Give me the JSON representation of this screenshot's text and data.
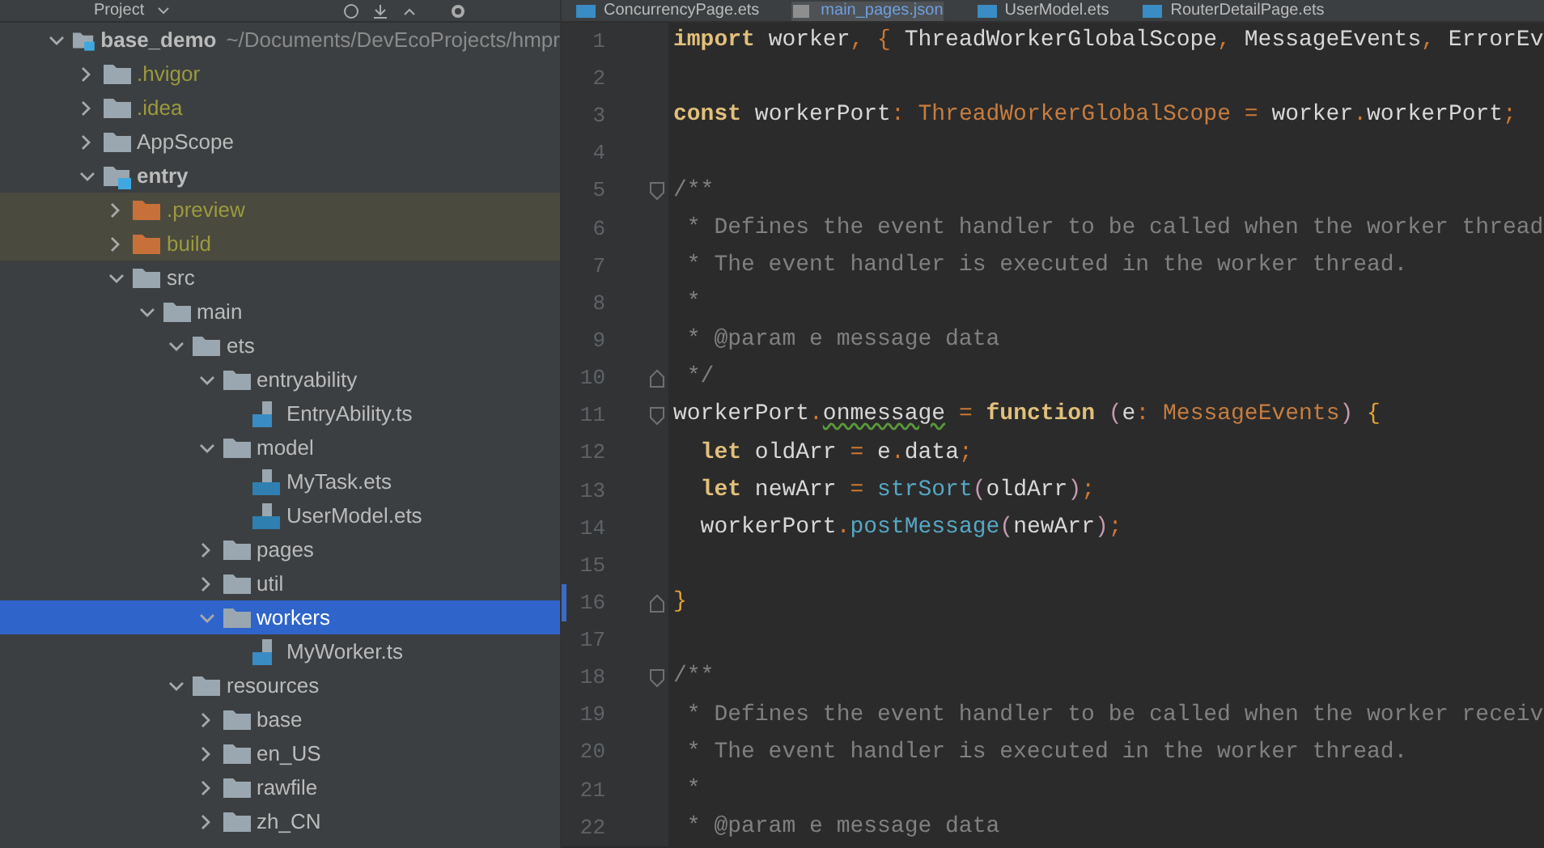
{
  "project_panel": {
    "title": "Project"
  },
  "editor_tabs": [
    {
      "label": "ConcurrencyPage.ets",
      "kind": "ets",
      "selected": false
    },
    {
      "label": "main_pages.json",
      "kind": "json",
      "selected": true
    },
    {
      "label": "UserModel.ets",
      "kind": "ets",
      "selected": false
    },
    {
      "label": "RouterDetailPage.ets",
      "kind": "ets",
      "selected": false
    }
  ],
  "tree": [
    {
      "name": "base_demo",
      "path": "~/Documents/DevEcoProjects/hmpr",
      "kind": "module",
      "expanded": true,
      "selected": false,
      "children": [
        {
          "name": ".hvigor",
          "kind": "folder",
          "expanded": false,
          "ignored": true,
          "excluded": false,
          "selected": false
        },
        {
          "name": ".idea",
          "kind": "folder",
          "expanded": false,
          "ignored": true,
          "excluded": false,
          "selected": false
        },
        {
          "name": "AppScope",
          "kind": "folder",
          "expanded": false,
          "ignored": false,
          "excluded": false,
          "selected": false
        },
        {
          "name": "entry",
          "kind": "module",
          "expanded": true,
          "ignored": false,
          "excluded": false,
          "selected": false,
          "children": [
            {
              "name": ".preview",
              "kind": "folder",
              "expanded": false,
              "ignored": true,
              "excluded": true,
              "selected": false
            },
            {
              "name": "build",
              "kind": "folder",
              "expanded": false,
              "ignored": true,
              "excluded": true,
              "selected": false
            },
            {
              "name": "src",
              "kind": "folder",
              "expanded": true,
              "ignored": false,
              "excluded": false,
              "selected": false,
              "children": [
                {
                  "name": "main",
                  "kind": "folder",
                  "expanded": true,
                  "ignored": false,
                  "excluded": false,
                  "selected": false,
                  "children": [
                    {
                      "name": "ets",
                      "kind": "folder",
                      "expanded": true,
                      "ignored": false,
                      "excluded": false,
                      "selected": false,
                      "children": [
                        {
                          "name": "entryability",
                          "kind": "folder",
                          "expanded": true,
                          "ignored": false,
                          "excluded": false,
                          "selected": false,
                          "children": [
                            {
                              "name": "EntryAbility.ts",
                              "kind": "ts",
                              "ignored": false,
                              "excluded": false,
                              "selected": false
                            }
                          ]
                        },
                        {
                          "name": "model",
                          "kind": "folder",
                          "expanded": true,
                          "ignored": false,
                          "excluded": false,
                          "selected": false,
                          "children": [
                            {
                              "name": "MyTask.ets",
                              "kind": "ets",
                              "ignored": false,
                              "excluded": false,
                              "selected": false
                            },
                            {
                              "name": "UserModel.ets",
                              "kind": "ets",
                              "ignored": false,
                              "excluded": false,
                              "selected": false
                            }
                          ]
                        },
                        {
                          "name": "pages",
                          "kind": "folder",
                          "expanded": false,
                          "ignored": false,
                          "excluded": false,
                          "selected": false
                        },
                        {
                          "name": "util",
                          "kind": "folder",
                          "expanded": false,
                          "ignored": false,
                          "excluded": false,
                          "selected": false
                        },
                        {
                          "name": "workers",
                          "kind": "folder",
                          "expanded": true,
                          "ignored": false,
                          "excluded": false,
                          "selected": true,
                          "children": [
                            {
                              "name": "MyWorker.ts",
                              "kind": "ts",
                              "ignored": false,
                              "excluded": false,
                              "selected": false
                            }
                          ]
                        }
                      ]
                    },
                    {
                      "name": "resources",
                      "kind": "folder",
                      "expanded": true,
                      "ignored": false,
                      "excluded": false,
                      "selected": false,
                      "children": [
                        {
                          "name": "base",
                          "kind": "folder",
                          "expanded": false,
                          "ignored": false,
                          "excluded": false,
                          "selected": false
                        },
                        {
                          "name": "en_US",
                          "kind": "folder",
                          "expanded": false,
                          "ignored": false,
                          "excluded": false,
                          "selected": false
                        },
                        {
                          "name": "rawfile",
                          "kind": "folder",
                          "expanded": false,
                          "ignored": false,
                          "excluded": false,
                          "selected": false
                        },
                        {
                          "name": "zh_CN",
                          "kind": "folder",
                          "expanded": false,
                          "ignored": false,
                          "excluded": false,
                          "selected": false
                        }
                      ]
                    }
                  ]
                }
              ]
            }
          ]
        }
      ]
    }
  ],
  "code": [
    {
      "number": "1",
      "kind": "plain",
      "tokens": [
        {
          "kind": "kw",
          "text": "import"
        },
        {
          "kind": "id",
          "text": " worker"
        },
        {
          "kind": "op",
          "text": ", { "
        },
        {
          "kind": "id",
          "text": "ThreadWorkerGlobalScope"
        },
        {
          "kind": "op",
          "text": ", "
        },
        {
          "kind": "id",
          "text": "MessageEvents"
        },
        {
          "kind": "op",
          "text": ", "
        },
        {
          "kind": "id",
          "text": "ErrorEv"
        }
      ]
    },
    {
      "number": "2",
      "kind": "plain"
    },
    {
      "number": "3",
      "kind": "plain",
      "tokens": [
        {
          "kind": "kw",
          "text": "const"
        },
        {
          "kind": "id",
          "text": " workerPort"
        },
        {
          "kind": "op",
          "text": ": "
        },
        {
          "kind": "type",
          "text": "ThreadWorkerGlobalScope"
        },
        {
          "kind": "op",
          "text": " = "
        },
        {
          "kind": "id",
          "text": "worker"
        },
        {
          "kind": "op",
          "text": "."
        },
        {
          "kind": "id",
          "text": "workerPort"
        },
        {
          "kind": "op",
          "text": ";"
        }
      ]
    },
    {
      "number": "4",
      "kind": "plain"
    },
    {
      "number": "5",
      "kind": "fold-start",
      "tokens": [
        {
          "kind": "cm",
          "text": "/**"
        }
      ]
    },
    {
      "number": "6",
      "kind": "plain",
      "tokens": [
        {
          "kind": "cm",
          "text": " * Defines the event handler to be called when the worker thread"
        }
      ]
    },
    {
      "number": "7",
      "kind": "plain",
      "tokens": [
        {
          "kind": "cm",
          "text": " * The event handler is executed in the worker thread."
        }
      ]
    },
    {
      "number": "8",
      "kind": "plain",
      "tokens": [
        {
          "kind": "cm",
          "text": " *"
        }
      ]
    },
    {
      "number": "9",
      "kind": "plain",
      "tokens": [
        {
          "kind": "cm",
          "text": " * @param e message data"
        }
      ]
    },
    {
      "number": "10",
      "kind": "fold-end",
      "tokens": [
        {
          "kind": "cm",
          "text": " */"
        }
      ]
    },
    {
      "number": "11",
      "kind": "fold-start",
      "tokens": [
        {
          "kind": "id",
          "text": "workerPort"
        },
        {
          "kind": "op",
          "text": "."
        },
        {
          "kind": "warn",
          "text": "onmessage"
        },
        {
          "kind": "op",
          "text": " = "
        },
        {
          "kind": "kw",
          "text": "function"
        },
        {
          "kind": "paren",
          "text": " ("
        },
        {
          "kind": "id",
          "text": "e"
        },
        {
          "kind": "op",
          "text": ": "
        },
        {
          "kind": "type",
          "text": "MessageEvents"
        },
        {
          "kind": "paren",
          "text": ")"
        },
        {
          "kind": "brace",
          "text": " {"
        }
      ]
    },
    {
      "number": "12",
      "kind": "plain",
      "tokens": [
        {
          "kind": "kw",
          "text": "  let"
        },
        {
          "kind": "id",
          "text": " oldArr"
        },
        {
          "kind": "op",
          "text": " = "
        },
        {
          "kind": "id",
          "text": "e"
        },
        {
          "kind": "op",
          "text": "."
        },
        {
          "kind": "id",
          "text": "data"
        },
        {
          "kind": "op",
          "text": ";"
        }
      ]
    },
    {
      "number": "13",
      "kind": "plain",
      "tokens": [
        {
          "kind": "kw",
          "text": "  let"
        },
        {
          "kind": "id",
          "text": " newArr"
        },
        {
          "kind": "op",
          "text": " = "
        },
        {
          "kind": "fn",
          "text": "strSort"
        },
        {
          "kind": "paren",
          "text": "("
        },
        {
          "kind": "id",
          "text": "oldArr"
        },
        {
          "kind": "paren",
          "text": ")"
        },
        {
          "kind": "op",
          "text": ";"
        }
      ]
    },
    {
      "number": "14",
      "kind": "plain",
      "tokens": [
        {
          "kind": "id",
          "text": "  workerPort"
        },
        {
          "kind": "op",
          "text": "."
        },
        {
          "kind": "fn",
          "text": "postMessage"
        },
        {
          "kind": "paren",
          "text": "("
        },
        {
          "kind": "id",
          "text": "newArr"
        },
        {
          "kind": "paren",
          "text": ")"
        },
        {
          "kind": "op",
          "text": ";"
        }
      ]
    },
    {
      "number": "15",
      "kind": "plain"
    },
    {
      "number": "16",
      "kind": "fold-end",
      "changed": true,
      "tokens": [
        {
          "kind": "brace",
          "text": "}"
        }
      ]
    },
    {
      "number": "17",
      "kind": "plain"
    },
    {
      "number": "18",
      "kind": "fold-start",
      "tokens": [
        {
          "kind": "cm",
          "text": "/**"
        }
      ]
    },
    {
      "number": "19",
      "kind": "plain",
      "tokens": [
        {
          "kind": "cm",
          "text": " * Defines the event handler to be called when the worker receiv"
        }
      ]
    },
    {
      "number": "20",
      "kind": "plain",
      "tokens": [
        {
          "kind": "cm",
          "text": " * The event handler is executed in the worker thread."
        }
      ]
    },
    {
      "number": "21",
      "kind": "plain",
      "tokens": [
        {
          "kind": "cm",
          "text": " *"
        }
      ]
    },
    {
      "number": "22",
      "kind": "plain",
      "tokens": [
        {
          "kind": "cm",
          "text": " * @param e message data"
        }
      ]
    }
  ]
}
